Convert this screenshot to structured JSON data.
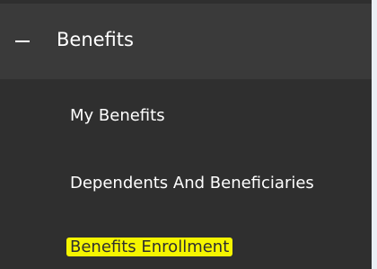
{
  "section": {
    "title": "Benefits",
    "collapse_icon": "minus-icon"
  },
  "menu": {
    "items": [
      {
        "label": "My Benefits"
      },
      {
        "label": "Dependents And Beneficiaries"
      },
      {
        "label": "Benefits Enrollment",
        "highlighted": true
      }
    ]
  },
  "colors": {
    "header_bg": "#3a3a3a",
    "menu_bg": "#2f2f2f",
    "text": "#ffffff",
    "highlight": "#f5f500"
  }
}
